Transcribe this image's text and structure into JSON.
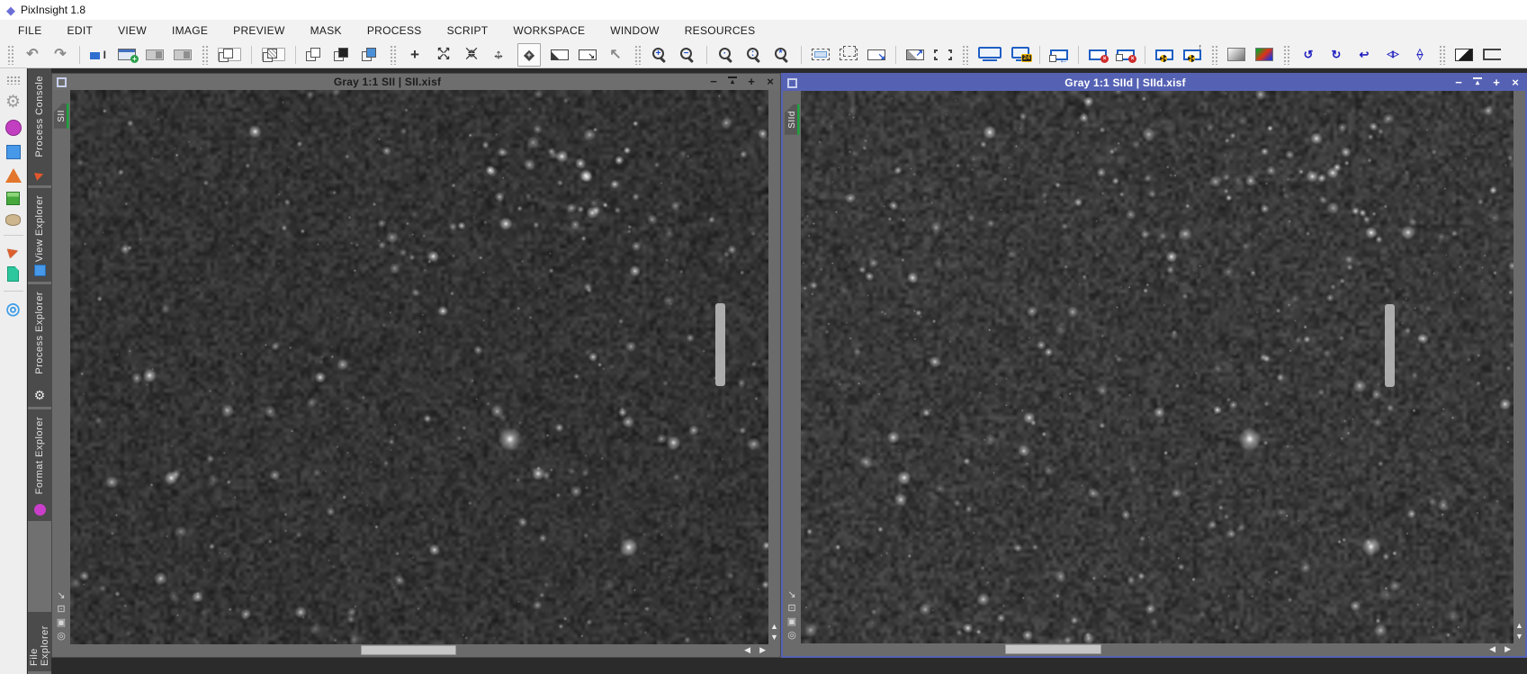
{
  "app": {
    "title": "PixInsight 1.8",
    "logo_glyph": "◆"
  },
  "menu": [
    "FILE",
    "EDIT",
    "VIEW",
    "IMAGE",
    "PREVIEW",
    "MASK",
    "PROCESS",
    "SCRIPT",
    "WORKSPACE",
    "WINDOW",
    "RESOURCES"
  ],
  "toolbar": [
    {
      "t": "h"
    },
    {
      "t": "i",
      "name": "undo-icon",
      "cls": "tg",
      "g": "↶"
    },
    {
      "t": "i",
      "name": "redo-icon",
      "cls": "tg",
      "g": "↷"
    },
    {
      "t": "s"
    },
    {
      "t": "i",
      "name": "edit-identifier-icon",
      "cls": "ident"
    },
    {
      "t": "i",
      "name": "new-image-icon",
      "cls": "newwin"
    },
    {
      "t": "i",
      "name": "save-image-icon",
      "cls": "winpair"
    },
    {
      "t": "i",
      "name": "save-image-as-icon",
      "cls": "winpair"
    },
    {
      "t": "h"
    },
    {
      "t": "i",
      "name": "duplicate-image-icon",
      "cls": "sq2",
      "p": true
    },
    {
      "t": "s"
    },
    {
      "t": "i",
      "name": "select-mask-icon",
      "cls": "sq2 hatch",
      "p": true
    },
    {
      "t": "s"
    },
    {
      "t": "i",
      "name": "clone-window-icon",
      "cls": "sq2"
    },
    {
      "t": "i",
      "name": "show-mask-icon",
      "cls": "sq2 black"
    },
    {
      "t": "i",
      "name": "mask-color-icon",
      "cls": "sq2 blue"
    },
    {
      "t": "h"
    },
    {
      "t": "i",
      "name": "readout-mode-icon",
      "cls": "tgd",
      "g": "+"
    },
    {
      "t": "i",
      "name": "zoom-in-mode-icon",
      "cls": "dbl a4out"
    },
    {
      "t": "i",
      "name": "zoom-out-mode-icon",
      "cls": "dbl a4in"
    },
    {
      "t": "i",
      "name": "move-mode-icon",
      "cls": "dbl amove"
    },
    {
      "t": "i",
      "name": "pan-mode-icon",
      "cls": "dbl pan",
      "p": true
    },
    {
      "t": "i",
      "name": "new-preview-mode-icon",
      "cls": "prev1"
    },
    {
      "t": "i",
      "name": "edit-preview-mode-icon",
      "cls": "prev2"
    },
    {
      "t": "i",
      "name": "select-mode-icon",
      "cls": "tg",
      "g": "↖"
    },
    {
      "t": "h"
    },
    {
      "t": "i",
      "name": "zoom-in-icon",
      "cls": "mag",
      "b": "+"
    },
    {
      "t": "i",
      "name": "zoom-out-icon",
      "cls": "mag",
      "b": "−"
    },
    {
      "t": "s"
    },
    {
      "t": "i",
      "name": "zoom-1-1-icon",
      "cls": "mag",
      "b": "·"
    },
    {
      "t": "i",
      "name": "zoom-to-fit-icon",
      "cls": "mag",
      "b": ":"
    },
    {
      "t": "i",
      "name": "zoom-optimal-icon",
      "cls": "mag",
      "b": "*"
    },
    {
      "t": "s"
    },
    {
      "t": "i",
      "name": "fit-view-icon",
      "cls": "dash blue"
    },
    {
      "t": "i",
      "name": "fit-views-all-icon",
      "cls": "dash two"
    },
    {
      "t": "i",
      "name": "resize-to-view-icon",
      "cls": "resz"
    },
    {
      "t": "s"
    },
    {
      "t": "i",
      "name": "expand-window-icon",
      "cls": "fitw"
    },
    {
      "t": "i",
      "name": "fit-window-icon",
      "cls": "brkt"
    },
    {
      "t": "h"
    },
    {
      "t": "i",
      "name": "screen-display-icon",
      "cls": "mon",
      "p": true
    },
    {
      "t": "i",
      "name": "color-depth-24-icon",
      "cls": "mon m24"
    },
    {
      "t": "s"
    },
    {
      "t": "i",
      "name": "restore-view-icon",
      "cls": "winarr"
    },
    {
      "t": "s"
    },
    {
      "t": "i",
      "name": "close-image-icon",
      "cls": "winx"
    },
    {
      "t": "i",
      "name": "close-all-images-icon",
      "cls": "winx two"
    },
    {
      "t": "s"
    },
    {
      "t": "i",
      "name": "stf-auto-stretch-icon",
      "cls": "stf"
    },
    {
      "t": "i",
      "name": "stf-boost-icon",
      "cls": "stf up"
    },
    {
      "t": "h"
    },
    {
      "t": "i",
      "name": "grayscale-swatch-icon",
      "cls": "swg"
    },
    {
      "t": "i",
      "name": "rgb-swatch-icon",
      "cls": "swc"
    },
    {
      "t": "h"
    },
    {
      "t": "i",
      "name": "rotate-image-icon",
      "cls": "tb",
      "g": "↺"
    },
    {
      "t": "i",
      "name": "rotate-90-icon",
      "cls": "tb",
      "g": "↻"
    },
    {
      "t": "i",
      "name": "rotate-180-icon",
      "cls": "tb",
      "g": "↩"
    },
    {
      "t": "i",
      "name": "mirror-horizontal-icon",
      "cls": "tb mh",
      "g": "◁▷"
    },
    {
      "t": "i",
      "name": "mirror-vertical-icon",
      "cls": "dbl mv"
    },
    {
      "t": "h"
    },
    {
      "t": "i",
      "name": "invert-image-icon",
      "cls": "inv"
    },
    {
      "t": "i",
      "name": "clipped-edge-icon",
      "cls": "half"
    }
  ],
  "favorites": [
    {
      "name": "toolbox-drag-handle",
      "cls": "fav-dots",
      "interactable": true
    },
    {
      "name": "gear-icon",
      "cls": "fav-gear",
      "g": "⚙",
      "interactable": true
    },
    {
      "name": "magenta-circle-icon",
      "cls": "fav-circle",
      "interactable": true
    },
    {
      "name": "blue-square-icon",
      "cls": "fav-square",
      "interactable": true
    },
    {
      "name": "orange-pyramid-icon",
      "cls": "fav-pyramid",
      "interactable": true
    },
    {
      "name": "green-cube-icon",
      "cls": "fav-cube",
      "interactable": true
    },
    {
      "name": "tan-cylinder-icon",
      "cls": "fav-cyl",
      "interactable": true
    },
    {
      "name": "favorites-separator",
      "cls": "fav-sep",
      "interactable": false
    },
    {
      "name": "orange-arrow-icon",
      "cls": "fav-plane",
      "g": "▶",
      "interactable": true
    },
    {
      "name": "teal-page-icon",
      "cls": "fav-page",
      "interactable": true
    },
    {
      "name": "favorites-separator",
      "cls": "fav-sep",
      "interactable": false
    },
    {
      "name": "blue-target-icon",
      "cls": "fav-target",
      "g": "◎",
      "interactable": true
    }
  ],
  "dock_tabs": [
    {
      "label": "Process Console",
      "cls": "dt-pc",
      "icon_name": "process-arrow-icon",
      "icon_cls": "di-pc",
      "g": "▶"
    },
    {
      "label": "View Explorer",
      "cls": "dt-ve",
      "icon_name": "view-square-icon",
      "icon_cls": "di-ve",
      "g": ""
    },
    {
      "label": "Process Explorer",
      "cls": "dt-pe",
      "icon_name": "gear-icon",
      "icon_cls": "di-pe",
      "g": "⚙"
    },
    {
      "label": "Format Explorer",
      "cls": "dt-fe",
      "icon_name": "format-circle-icon",
      "icon_cls": "di-fe",
      "g": ""
    },
    {
      "label": "File Explorer",
      "cls": "dt-file",
      "icon_name": "",
      "icon_cls": "",
      "g": ""
    }
  ],
  "window_controls": [
    {
      "name": "minimize-button",
      "glyph": "−"
    },
    {
      "name": "shade-button",
      "glyph": "▴"
    },
    {
      "name": "maximize-button",
      "glyph": "+"
    },
    {
      "name": "close-button",
      "glyph": "×"
    }
  ],
  "gadgets": [
    {
      "name": "resize-corner-icon",
      "glyph": "↘"
    },
    {
      "name": "fit-frame-icon",
      "glyph": "⊡"
    },
    {
      "name": "clone-gadget-icon",
      "glyph": "▣"
    },
    {
      "name": "sync-gadget-icon",
      "glyph": "◎"
    }
  ],
  "scroll": {
    "up": "▲",
    "down": "▼",
    "left": "◀",
    "right": "▶"
  },
  "windows": [
    {
      "title": "Gray 1:1 SII | SII.xisf",
      "tab_label": "SII",
      "active": false
    },
    {
      "title": "Gray 1:1 SIId | SIId.xisf",
      "tab_label": "SIId",
      "active": true
    }
  ],
  "colors": {
    "active_titlebar": "#5562b4",
    "inactive_titlebar": "#6e6e6e",
    "view_tab_stripe": "#1ca23c",
    "workspace_background": "#2b2b2b"
  }
}
